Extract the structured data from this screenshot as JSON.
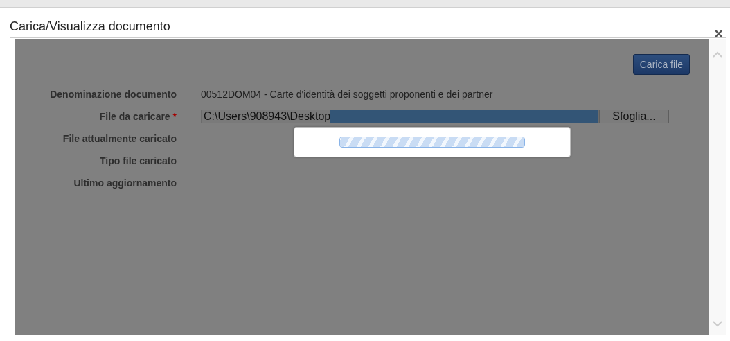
{
  "dialog": {
    "title": "Carica/Visualizza documento",
    "close": "×"
  },
  "upload_button": "Carica file",
  "fields": [
    {
      "kind": "text",
      "label": "Denominazione documento",
      "value": "00512DOM04 - Carte d'identità dei soggetti proponenti e dei partner"
    },
    {
      "kind": "file",
      "label": "File da caricare",
      "required": true,
      "value": "C:\\Users\\908943\\Desktop",
      "button": "Sfoglia..."
    },
    {
      "kind": "text",
      "label": "File attualmente caricato"
    },
    {
      "kind": "text",
      "label": "Tipo file caricato"
    },
    {
      "kind": "text",
      "label": "Ultimo aggiornamento"
    }
  ],
  "progress": {
    "level": 1
  },
  "required_mark": "*"
}
